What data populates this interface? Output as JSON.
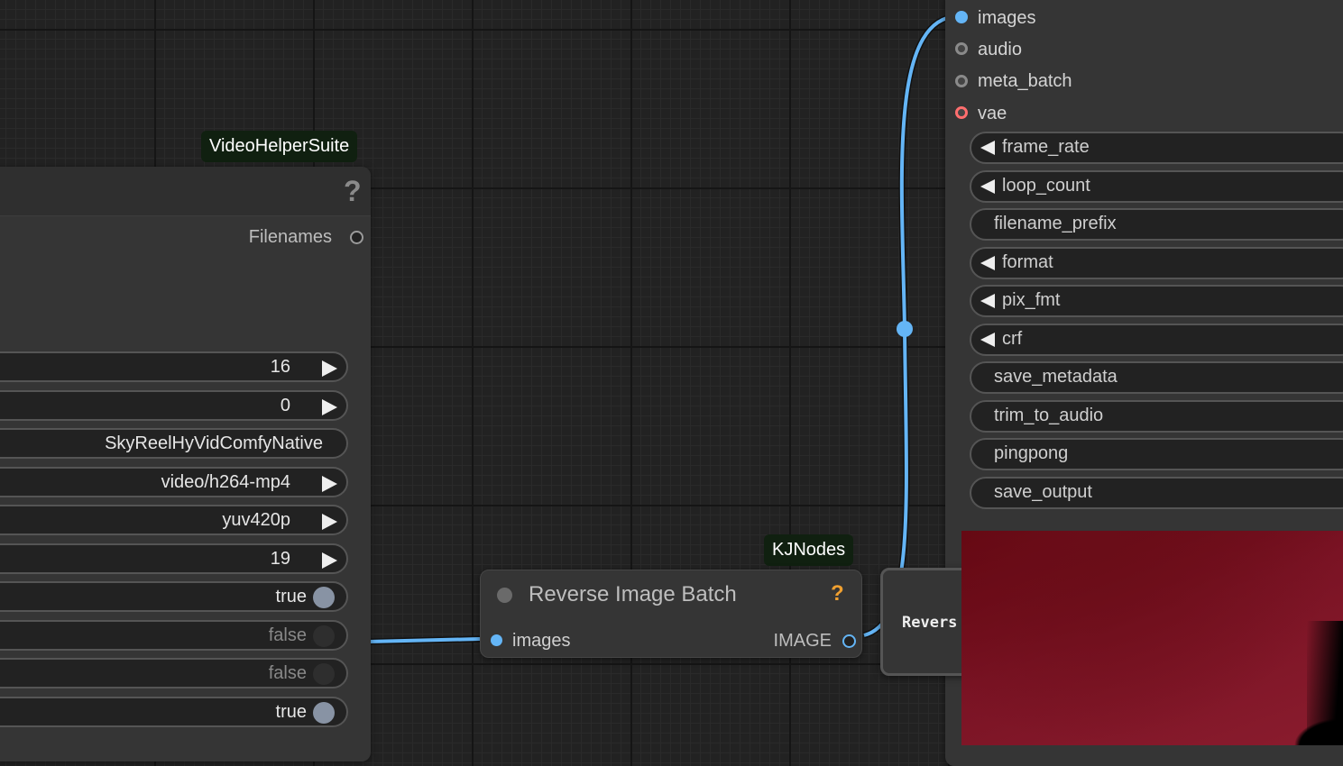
{
  "colors": {
    "link": "#64b5f6",
    "image_slot": "#64b5f6",
    "vae_slot": "#ff6e6e",
    "badge_bg": "#102010",
    "accent_help": "#f0a030",
    "preview": "#7a1324"
  },
  "vhs_node": {
    "source_badge": "VideoHelperSuite",
    "help_icon": "?",
    "output_label": "Filenames",
    "widgets": [
      {
        "value": "16",
        "control": "step-arrow"
      },
      {
        "value": "0",
        "control": "step-arrow"
      },
      {
        "value": "SkyReelHyVidComfyNative",
        "control": "text"
      },
      {
        "value": "video/h264-mp4",
        "control": "combo-arrow"
      },
      {
        "value": "yuv420p",
        "control": "combo-arrow"
      },
      {
        "value": "19",
        "control": "step-arrow"
      },
      {
        "value": "true",
        "control": "toggle-on"
      },
      {
        "value": "false",
        "control": "toggle-off"
      },
      {
        "value": "false",
        "control": "toggle-off"
      },
      {
        "value": "true",
        "control": "toggle-on"
      }
    ]
  },
  "reverse_node": {
    "source_badge": "KJNodes",
    "title": "Reverse Image Batch",
    "help_icon": "?",
    "input_label": "images",
    "output_label": "IMAGE"
  },
  "right_node": {
    "inputs": [
      "images",
      "audio",
      "meta_batch",
      "vae"
    ],
    "widgets": [
      {
        "label": "frame_rate",
        "arrow": true
      },
      {
        "label": "loop_count",
        "arrow": true
      },
      {
        "label": "filename_prefix",
        "arrow": false
      },
      {
        "label": "format",
        "arrow": true
      },
      {
        "label": "pix_fmt",
        "arrow": true
      },
      {
        "label": "crf",
        "arrow": true
      },
      {
        "label": "save_metadata",
        "arrow": false
      },
      {
        "label": "trim_to_audio",
        "arrow": false
      },
      {
        "label": "pingpong",
        "arrow": false
      },
      {
        "label": "save_output",
        "arrow": false
      }
    ]
  },
  "mini_node": {
    "title": "Revers"
  }
}
